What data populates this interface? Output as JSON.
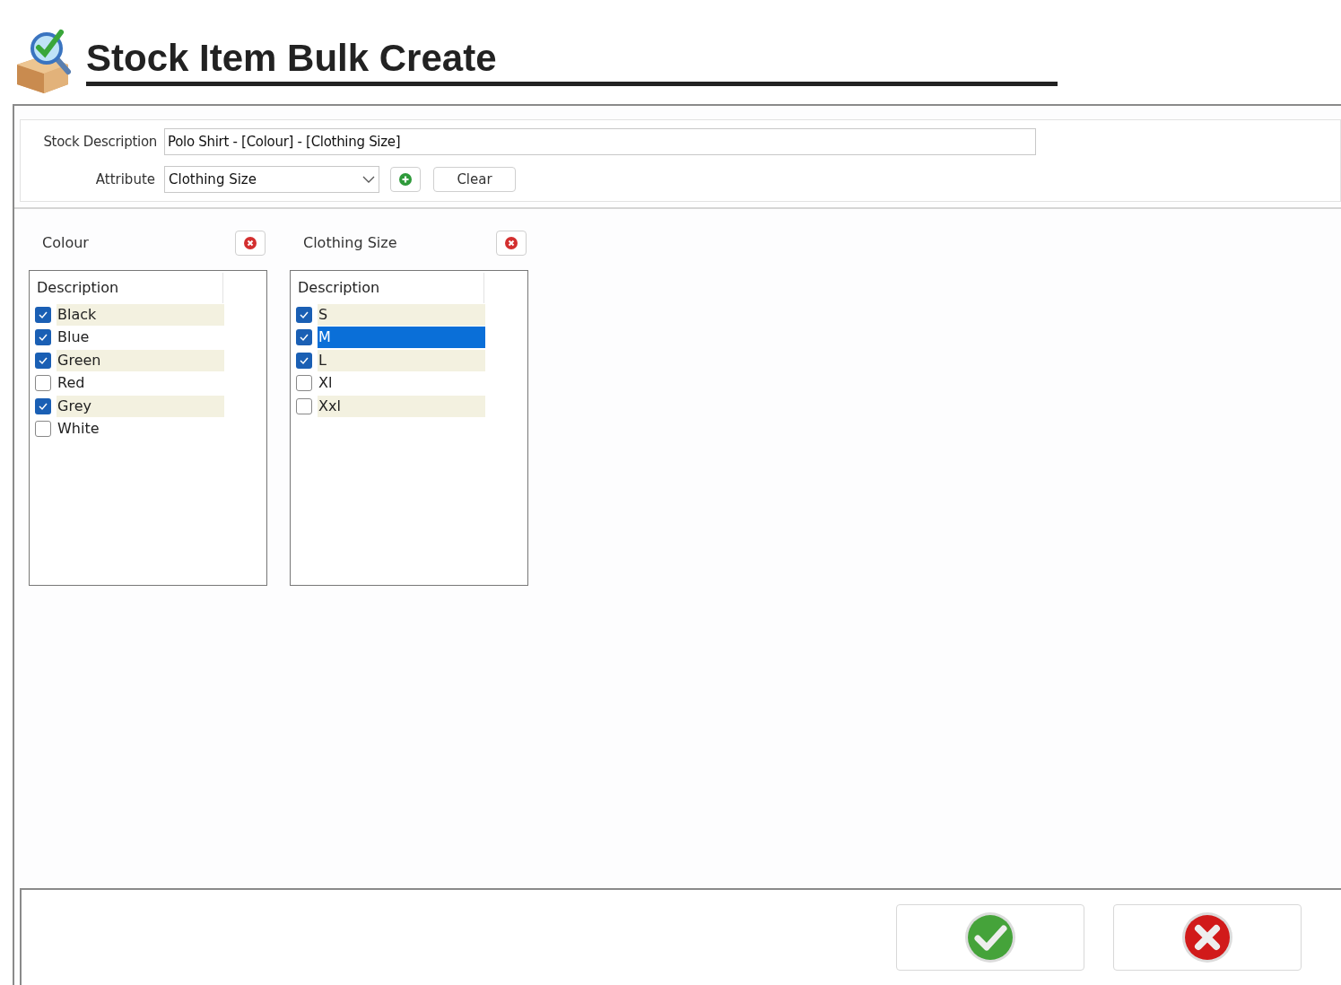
{
  "title": "Stock Item Bulk Create",
  "form": {
    "description_label": "Stock Description",
    "description_value": "Polo Shirt - [Colour] - [Clothing Size]",
    "attribute_label": "Attribute",
    "attribute_value": "Clothing Size",
    "clear_button": "Clear"
  },
  "attributes": [
    {
      "name": "Colour",
      "column": "Description",
      "items": [
        {
          "label": "Black",
          "checked": true,
          "selected": false
        },
        {
          "label": "Blue",
          "checked": true,
          "selected": false
        },
        {
          "label": "Green",
          "checked": true,
          "selected": false
        },
        {
          "label": "Red",
          "checked": false,
          "selected": false
        },
        {
          "label": "Grey",
          "checked": true,
          "selected": false
        },
        {
          "label": "White",
          "checked": false,
          "selected": false
        }
      ]
    },
    {
      "name": "Clothing Size",
      "column": "Description",
      "items": [
        {
          "label": "S",
          "checked": true,
          "selected": false
        },
        {
          "label": "M",
          "checked": true,
          "selected": true
        },
        {
          "label": "L",
          "checked": true,
          "selected": false
        },
        {
          "label": "Xl",
          "checked": false,
          "selected": false
        },
        {
          "label": "Xxl",
          "checked": false,
          "selected": false
        }
      ]
    }
  ]
}
